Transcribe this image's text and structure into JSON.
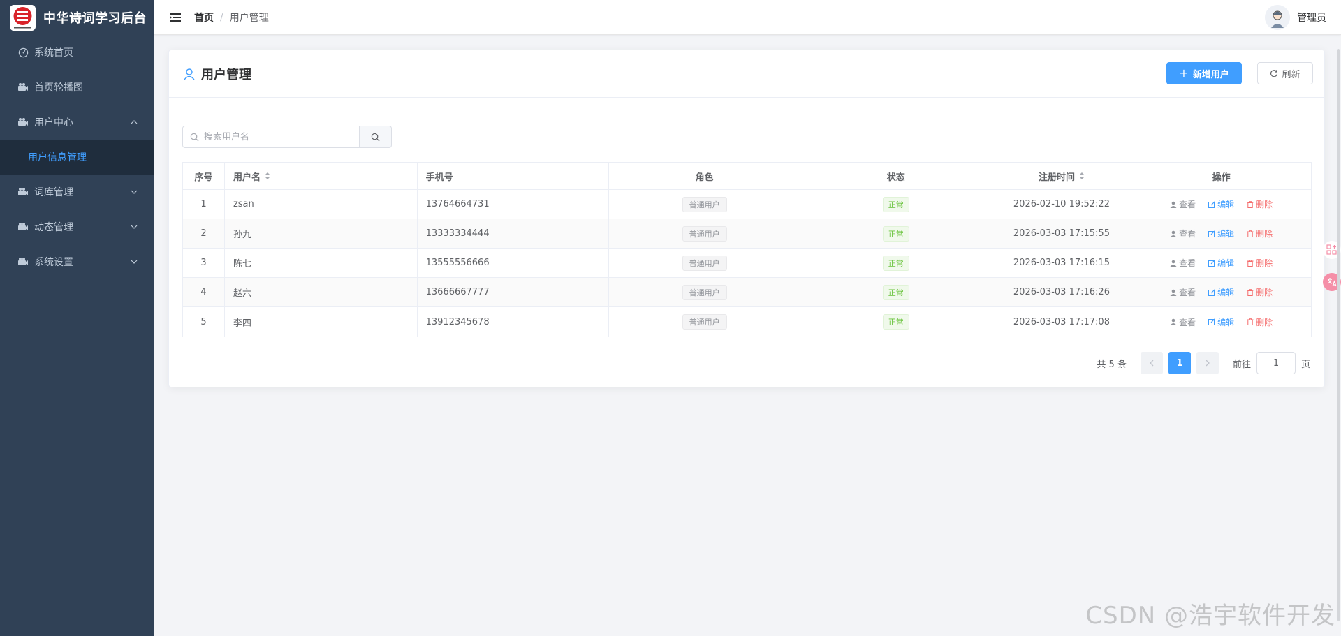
{
  "app": {
    "title": "中华诗词学习后台"
  },
  "sidebar": {
    "items": [
      {
        "label": "系统首页",
        "icon": "dashboard-icon"
      },
      {
        "label": "首页轮播图",
        "icon": "camera-icon"
      },
      {
        "label": "用户中心",
        "icon": "camera-icon",
        "expanded": true,
        "children": [
          {
            "label": "用户信息管理",
            "active": true
          }
        ]
      },
      {
        "label": "词库管理",
        "icon": "camera-icon"
      },
      {
        "label": "动态管理",
        "icon": "camera-icon"
      },
      {
        "label": "系统设置",
        "icon": "camera-icon"
      }
    ]
  },
  "header": {
    "breadcrumb": {
      "home": "首页",
      "sep": "/",
      "current": "用户管理"
    },
    "user": {
      "name": "管理员"
    }
  },
  "card": {
    "title": "用户管理",
    "add_button": "新增用户",
    "refresh_button": "刷新"
  },
  "search": {
    "placeholder": "搜索用户名"
  },
  "table": {
    "headers": {
      "index": "序号",
      "username": "用户名",
      "phone": "手机号",
      "role": "角色",
      "status": "状态",
      "created": "注册时间",
      "actions": "操作"
    },
    "rows": [
      {
        "index": "1",
        "username": "zsan",
        "phone": "13764664731",
        "role": "普通用户",
        "status": "正常",
        "created": "2026-02-10 19:52:22"
      },
      {
        "index": "2",
        "username": "孙九",
        "phone": "13333334444",
        "role": "普通用户",
        "status": "正常",
        "created": "2026-03-03 17:15:55"
      },
      {
        "index": "3",
        "username": "陈七",
        "phone": "13555556666",
        "role": "普通用户",
        "status": "正常",
        "created": "2026-03-03 17:16:15"
      },
      {
        "index": "4",
        "username": "赵六",
        "phone": "13666667777",
        "role": "普通用户",
        "status": "正常",
        "created": "2026-03-03 17:16:26"
      },
      {
        "index": "5",
        "username": "李四",
        "phone": "13912345678",
        "role": "普通用户",
        "status": "正常",
        "created": "2026-03-03 17:17:08"
      }
    ],
    "actions": {
      "view": "查看",
      "edit": "编辑",
      "delete": "删除"
    }
  },
  "pagination": {
    "total": "共 5 条",
    "current_page": "1",
    "goto_label": "前往",
    "goto_value": "1",
    "page_suffix": "页"
  },
  "watermark": "CSDN @浩宇软件开发",
  "colors": {
    "sidebar_bg": "#304156",
    "sidebar_active_bg": "#1f2d3d",
    "primary": "#409eff",
    "success": "#67c23a",
    "danger": "#f56c6c"
  }
}
